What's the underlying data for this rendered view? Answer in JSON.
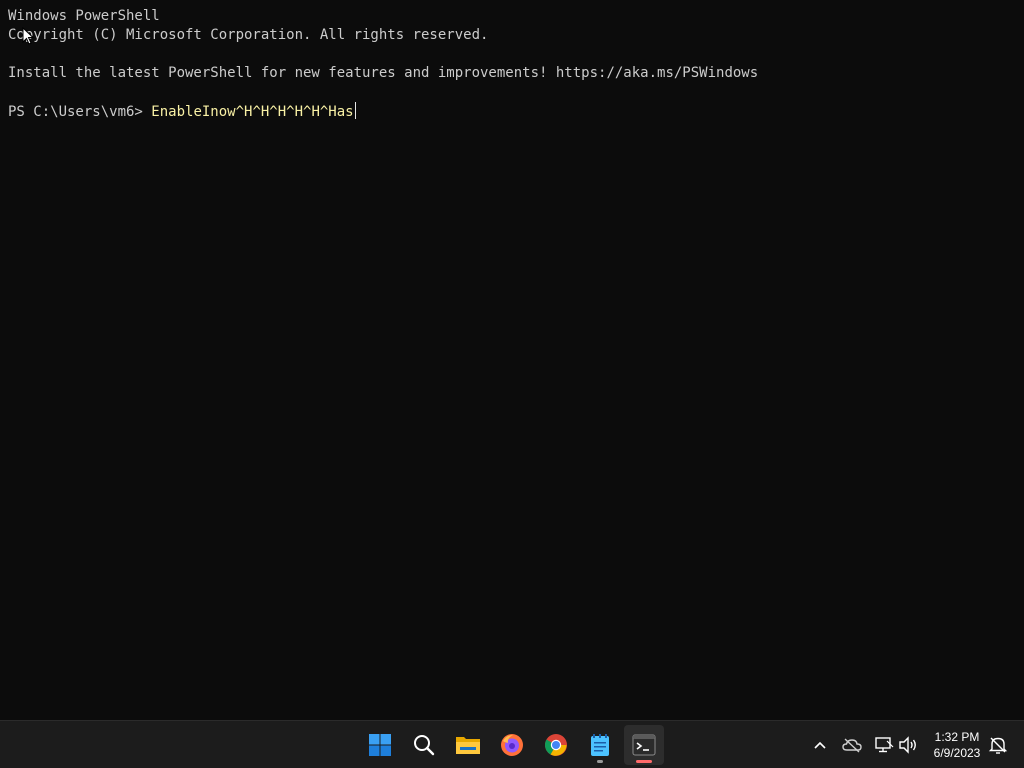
{
  "terminal": {
    "header_line": "Windows PowerShell",
    "copyright_line": "Copyright (C) Microsoft Corporation. All rights reserved.",
    "install_line": "Install the latest PowerShell for new features and improvements! https://aka.ms/PSWindows",
    "prompt": "PS C:\\Users\\vm6> ",
    "command": "EnableInow^H^H^H^H^H^Has"
  },
  "taskbar": {
    "apps": [
      {
        "name": "Start",
        "icon": "windows-logo-icon"
      },
      {
        "name": "Search",
        "icon": "search-icon"
      },
      {
        "name": "File Explorer",
        "icon": "folder-icon"
      },
      {
        "name": "Firefox",
        "icon": "firefox-icon"
      },
      {
        "name": "Chrome",
        "icon": "chrome-icon"
      },
      {
        "name": "Notepad",
        "icon": "notepad-icon"
      },
      {
        "name": "Terminal",
        "icon": "terminal-icon"
      }
    ],
    "tray": {
      "icons": [
        "chevron-up-icon",
        "onedrive-icon",
        "network-icon",
        "volume-icon",
        "notification-icon"
      ],
      "time": "1:32 PM",
      "date": "6/9/2023"
    }
  },
  "colors": {
    "terminal_bg": "#0c0c0c",
    "terminal_fg": "#cccccc",
    "command_fg": "#f9f1a5",
    "taskbar_bg": "#1c1c1c",
    "accent_blue": "#0078d4"
  }
}
